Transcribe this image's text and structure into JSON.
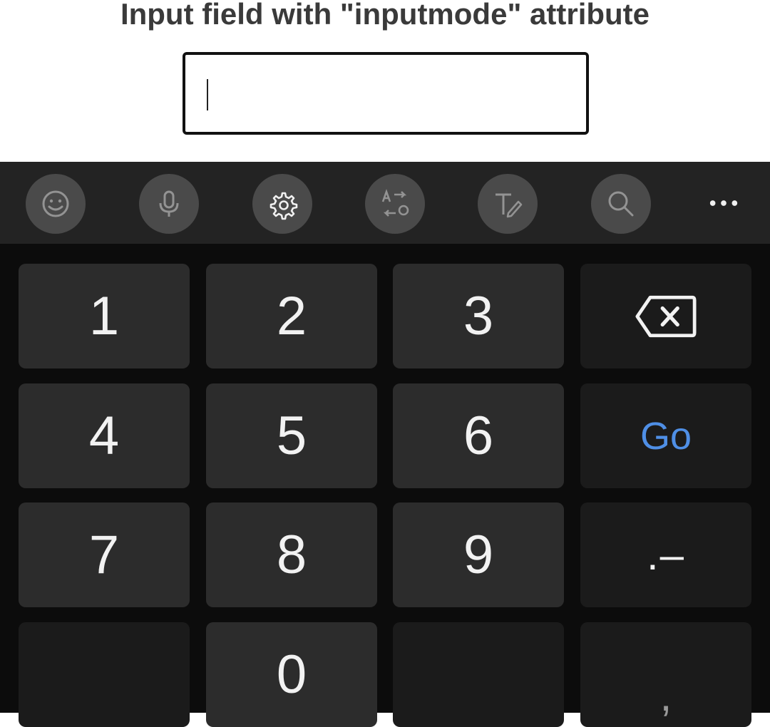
{
  "page": {
    "title": "Input field with \"inputmode\" attribute"
  },
  "input": {
    "value": ""
  },
  "keyboard": {
    "toolbar": {
      "buttons": [
        {
          "name": "emoji-icon"
        },
        {
          "name": "microphone-icon"
        },
        {
          "name": "gear-icon"
        },
        {
          "name": "translate-icon"
        },
        {
          "name": "handwriting-icon"
        },
        {
          "name": "search-icon"
        }
      ],
      "more": "more-options-icon"
    },
    "keys": {
      "k1": "1",
      "k2": "2",
      "k3": "3",
      "k4": "4",
      "k5": "5",
      "k6": "6",
      "k7": "7",
      "k8": "8",
      "k9": "9",
      "k0": "0",
      "go": "Go",
      "dot_dash": ".–",
      "comma": ","
    },
    "colors": {
      "go_accent": "#4f8fe6",
      "key_bg": "#2c2c2c",
      "func_key_bg": "#1b1b1b",
      "toolbar_bg": "#232323"
    }
  }
}
